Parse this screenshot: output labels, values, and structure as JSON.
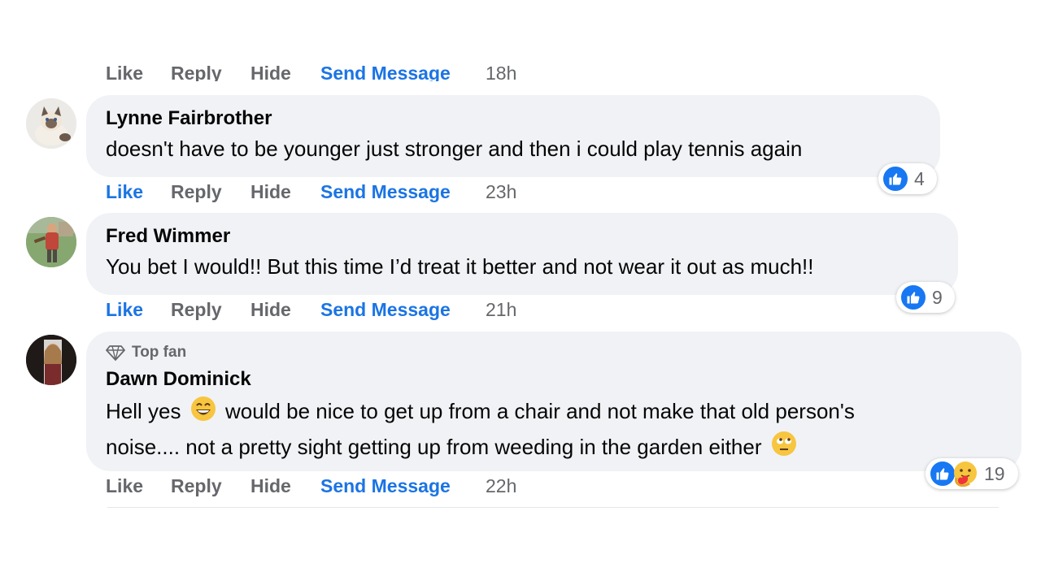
{
  "top_actions": {
    "like": "Like",
    "reply": "Reply",
    "hide": "Hide",
    "send": "Send Message",
    "time": "18h"
  },
  "comments": [
    {
      "author": "Lynne Fairbrother",
      "text": "doesn't have to be younger just stronger and then i could play tennis again",
      "reaction_count": "4",
      "like": "Like",
      "reply": "Reply",
      "hide": "Hide",
      "send": "Send Message",
      "time": "23h"
    },
    {
      "author": "Fred Wimmer",
      "text": "You bet I would!! But this time I’d treat it better and not wear it out as much!!",
      "reaction_count": "9",
      "like": "Like",
      "reply": "Reply",
      "hide": "Hide",
      "send": "Send Message",
      "time": "21h"
    },
    {
      "badge": "Top fan",
      "author": "Dawn Dominick",
      "text_1": "Hell yes",
      "text_2": "would be nice to get up from a chair and not make that old person's",
      "text_3": "noise.... not a pretty sight getting up from weeding in the garden either",
      "reaction_count": "19",
      "like": "Like",
      "reply": "Reply",
      "hide": "Hide",
      "send": "Send Message",
      "time": "22h"
    }
  ],
  "colors": {
    "link_blue": "#1b74e4",
    "secondary_text": "#65676b",
    "bubble_bg": "#f0f2f5",
    "like_blue": "#1877f2"
  },
  "icons": [
    "thumbs-up-icon",
    "care-reaction-icon",
    "diamond-icon",
    "grinning-emoji-icon",
    "eye-roll-emoji-icon"
  ]
}
